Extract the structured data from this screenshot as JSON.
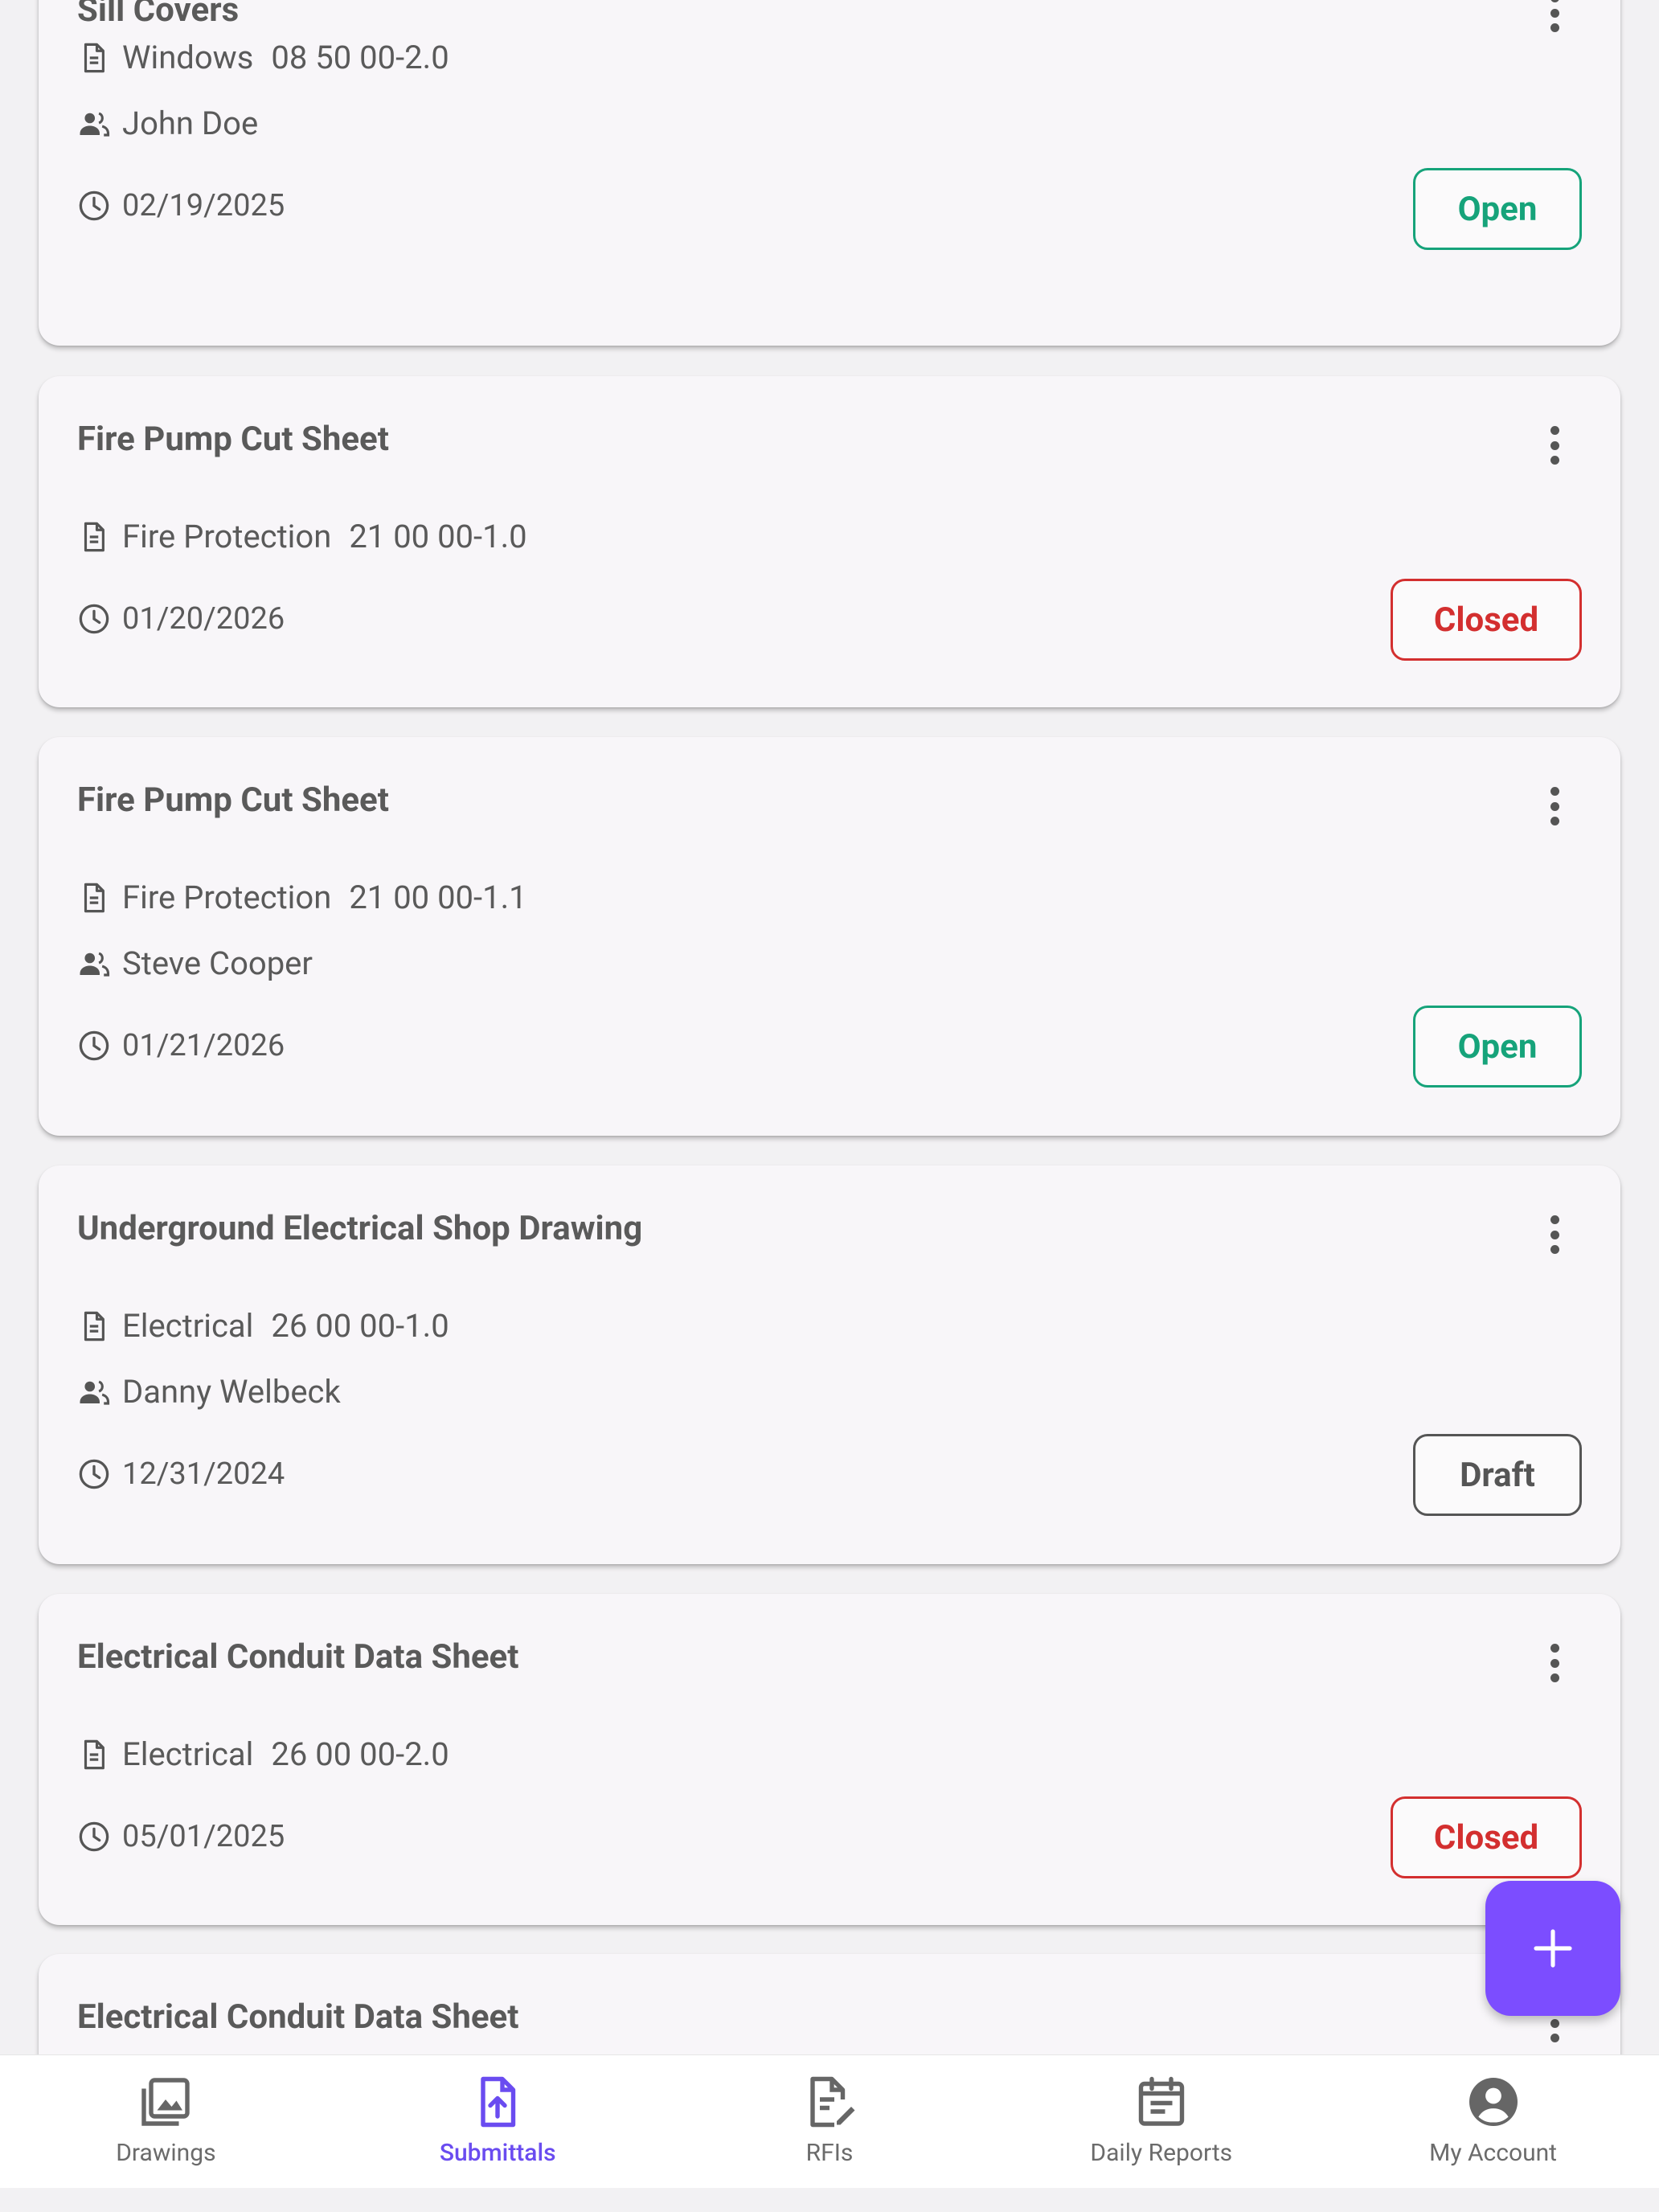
{
  "submittals": [
    {
      "title": "Sill Covers",
      "category": "Windows",
      "spec": "08 50 00-2.0",
      "assignee": "John Doe",
      "date": "02/19/2025",
      "status": "Open"
    },
    {
      "title": "Fire Pump Cut Sheet",
      "category": "Fire Protection",
      "spec": "21 00 00-1.0",
      "assignee": "",
      "date": "01/20/2026",
      "status": "Closed"
    },
    {
      "title": "Fire Pump Cut Sheet",
      "category": "Fire Protection",
      "spec": "21 00 00-1.1",
      "assignee": "Steve Cooper",
      "date": "01/21/2026",
      "status": "Open"
    },
    {
      "title": "Underground Electrical Shop Drawing",
      "category": "Electrical",
      "spec": "26 00 00-1.0",
      "assignee": "Danny Welbeck",
      "date": "12/31/2024",
      "status": "Draft"
    },
    {
      "title": "Electrical Conduit Data Sheet",
      "category": "Electrical",
      "spec": "26 00 00-2.0",
      "assignee": "",
      "date": "05/01/2025",
      "status": "Closed"
    },
    {
      "title": "Electrical Conduit Data Sheet"
    }
  ],
  "colors": {
    "open": "#16a37a",
    "closed": "#d32f2f",
    "draft": "#555555",
    "accent": "#7c4dff",
    "nav_active": "#6a4cf0"
  },
  "fab": {
    "icon": "plus-icon"
  },
  "nav": {
    "items": [
      {
        "label": "Drawings",
        "icon": "drawings-icon",
        "active": false
      },
      {
        "label": "Submittals",
        "icon": "submittals-icon",
        "active": true
      },
      {
        "label": "RFIs",
        "icon": "rfis-icon",
        "active": false
      },
      {
        "label": "Daily Reports",
        "icon": "daily-reports-icon",
        "active": false
      },
      {
        "label": "My Account",
        "icon": "account-icon",
        "active": false
      }
    ]
  }
}
